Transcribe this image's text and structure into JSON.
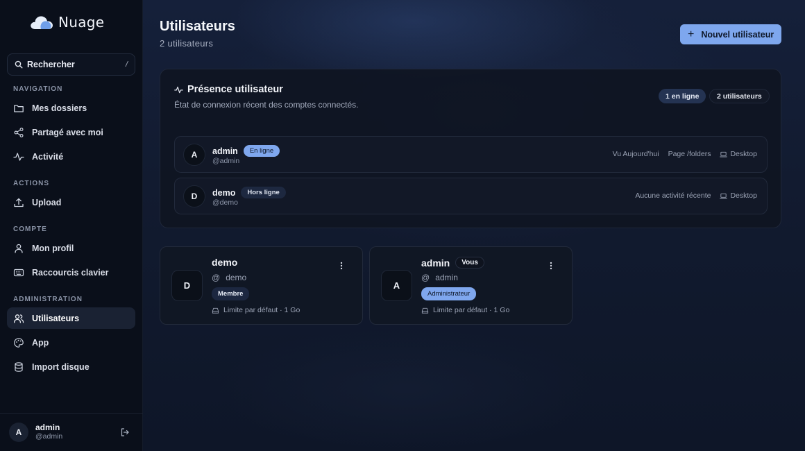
{
  "brand": {
    "name": "Nuage"
  },
  "search": {
    "placeholder": "Rechercher",
    "shortcut": "/"
  },
  "nav": {
    "sections": {
      "navigation": "NAVIGATION",
      "actions": "ACTIONS",
      "account": "COMPTE",
      "admin": "ADMINISTRATION"
    },
    "items": {
      "folders": "Mes dossiers",
      "shared": "Partagé avec moi",
      "activity": "Activité",
      "upload": "Upload",
      "profile": "Mon profil",
      "shortcuts": "Raccourcis clavier",
      "users": "Utilisateurs",
      "app": "App",
      "import": "Import disque"
    }
  },
  "current_user": {
    "initial": "A",
    "name": "admin",
    "handle": "@admin"
  },
  "header": {
    "title": "Utilisateurs",
    "subtitle": "2 utilisateurs",
    "new_user_label": "Nouvel utilisateur"
  },
  "presence": {
    "title": "Présence utilisateur",
    "subtitle": "État de connexion récent des comptes connectés.",
    "online_count": "1 en ligne",
    "user_count": "2 utilisateurs",
    "rows": [
      {
        "initial": "A",
        "name": "admin",
        "handle": "@admin",
        "status": "En ligne",
        "seen": "Vu Aujourd'hui",
        "page": "Page /folders",
        "device": "Desktop"
      },
      {
        "initial": "D",
        "name": "demo",
        "handle": "@demo",
        "status": "Hors ligne",
        "seen": "Aucune activité récente",
        "device": "Desktop"
      }
    ]
  },
  "users": [
    {
      "initial": "D",
      "name": "demo",
      "at": "@",
      "handle": "demo",
      "role": "Membre",
      "limit": "Limite par défaut · 1 Go"
    },
    {
      "initial": "A",
      "name": "admin",
      "you": "Vous",
      "at": "@",
      "handle": "admin",
      "role": "Administrateur",
      "limit": "Limite par défaut · 1 Go"
    }
  ],
  "colors": {
    "accent": "#7ea7ee",
    "background": "#0e1524",
    "sidebar": "#0a0f1a"
  }
}
